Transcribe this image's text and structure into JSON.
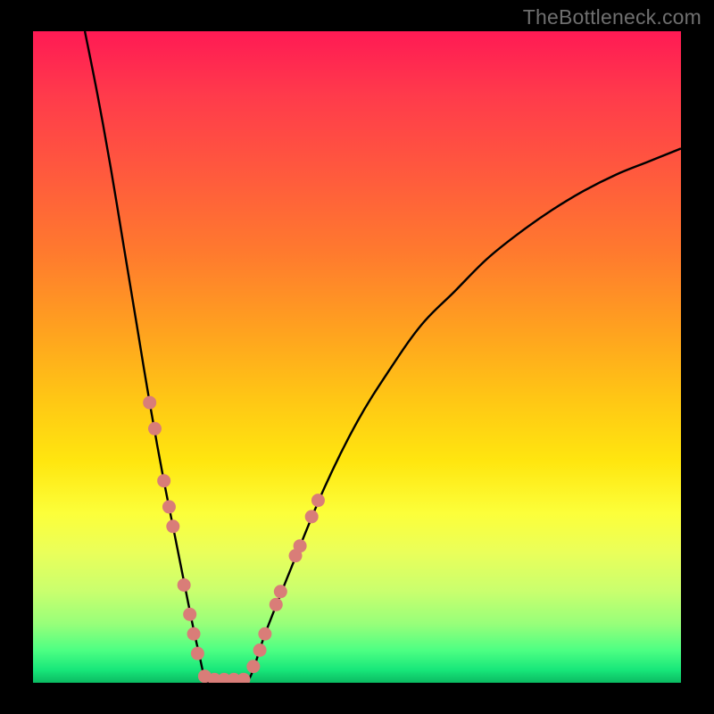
{
  "watermark": "TheBottleneck.com",
  "colors": {
    "frame": "#000000",
    "curve": "#000000",
    "dots": "#d97d78",
    "gradient_stops": [
      {
        "pos": 0.0,
        "hex": "#ff1a54"
      },
      {
        "pos": 0.1,
        "hex": "#ff3b4b"
      },
      {
        "pos": 0.22,
        "hex": "#ff5a3d"
      },
      {
        "pos": 0.34,
        "hex": "#ff7a2e"
      },
      {
        "pos": 0.46,
        "hex": "#ffa21f"
      },
      {
        "pos": 0.56,
        "hex": "#ffc515"
      },
      {
        "pos": 0.66,
        "hex": "#ffe60f"
      },
      {
        "pos": 0.74,
        "hex": "#fcff3a"
      },
      {
        "pos": 0.8,
        "hex": "#eaff5a"
      },
      {
        "pos": 0.86,
        "hex": "#c9ff6e"
      },
      {
        "pos": 0.91,
        "hex": "#97ff7a"
      },
      {
        "pos": 0.95,
        "hex": "#4dff83"
      },
      {
        "pos": 0.98,
        "hex": "#18e77a"
      },
      {
        "pos": 1.0,
        "hex": "#0bba62"
      }
    ]
  },
  "chart_data": {
    "type": "line",
    "title": "",
    "xlabel": "",
    "ylabel": "",
    "xlim": [
      0,
      100
    ],
    "ylim": [
      0,
      100
    ],
    "series": [
      {
        "name": "left-branch",
        "x": [
          8,
          10,
          12,
          14,
          16,
          18,
          20,
          22,
          24,
          25.5,
          27
        ],
        "y": [
          100,
          90,
          79,
          67,
          55,
          43,
          32,
          22,
          12,
          5,
          0
        ]
      },
      {
        "name": "valley-floor",
        "x": [
          27,
          30,
          33
        ],
        "y": [
          0,
          0,
          0
        ]
      },
      {
        "name": "right-branch",
        "x": [
          33,
          36,
          40,
          45,
          50,
          55,
          60,
          65,
          70,
          75,
          80,
          85,
          90,
          95,
          100
        ],
        "y": [
          0,
          8,
          18,
          30,
          40,
          48,
          55,
          60,
          65,
          69,
          72.5,
          75.5,
          78,
          80,
          82
        ]
      }
    ],
    "scatter": {
      "name": "highlighted-points",
      "points": [
        {
          "x": 18.0,
          "y": 43
        },
        {
          "x": 18.8,
          "y": 39
        },
        {
          "x": 20.2,
          "y": 31
        },
        {
          "x": 21.0,
          "y": 27
        },
        {
          "x": 21.6,
          "y": 24
        },
        {
          "x": 23.3,
          "y": 15
        },
        {
          "x": 24.2,
          "y": 10.5
        },
        {
          "x": 24.8,
          "y": 7.5
        },
        {
          "x": 25.4,
          "y": 4.5
        },
        {
          "x": 26.5,
          "y": 1.0
        },
        {
          "x": 28.0,
          "y": 0.5
        },
        {
          "x": 29.5,
          "y": 0.5
        },
        {
          "x": 31.0,
          "y": 0.5
        },
        {
          "x": 32.5,
          "y": 0.5
        },
        {
          "x": 34.0,
          "y": 2.5
        },
        {
          "x": 35.0,
          "y": 5.0
        },
        {
          "x": 35.8,
          "y": 7.5
        },
        {
          "x": 37.5,
          "y": 12.0
        },
        {
          "x": 38.2,
          "y": 14.0
        },
        {
          "x": 40.5,
          "y": 19.5
        },
        {
          "x": 41.2,
          "y": 21.0
        },
        {
          "x": 43.0,
          "y": 25.5
        },
        {
          "x": 44.0,
          "y": 28.0
        }
      ]
    }
  }
}
